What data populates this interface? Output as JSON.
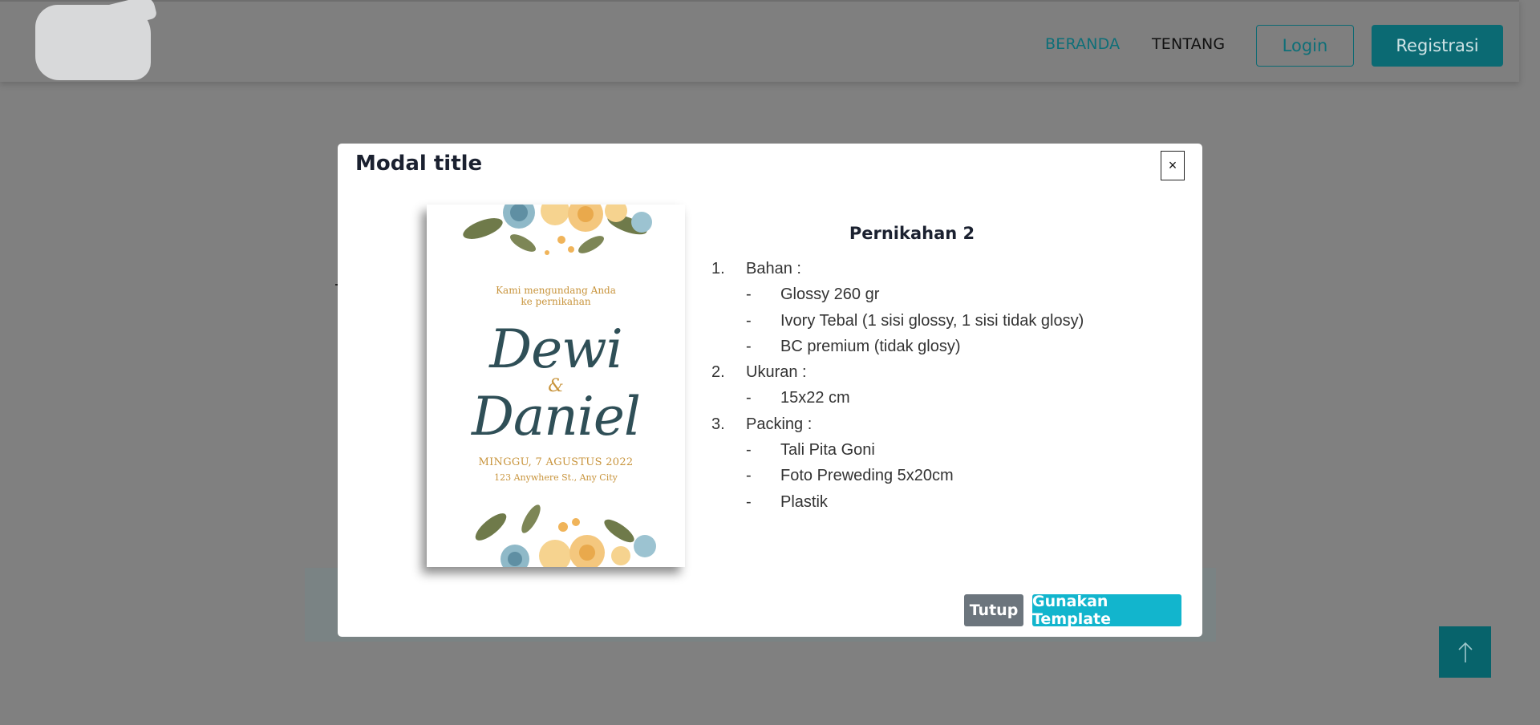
{
  "navbar": {
    "links": [
      "BERANDA",
      "TENTANG"
    ],
    "login_label": "Login",
    "register_label": "Registrasi"
  },
  "modal": {
    "title": "Modal title",
    "close_label": "×",
    "preview": {
      "lead_line1": "Kami mengundang Anda",
      "lead_line2": "ke pernikahan",
      "name1": "Dewi",
      "ampersand": "&",
      "name2": "Daniel",
      "date": "MINGGU, 7 AGUSTUS 2022",
      "address": "123 Anywhere St., Any City"
    },
    "product_title": "Pernikahan 2",
    "specs": [
      {
        "num": "1.",
        "label": "Bahan :",
        "items": [
          "Glossy 260 gr",
          "Ivory Tebal (1 sisi glossy, 1 sisi tidak glosy)",
          "BC premium (tidak glosy)"
        ]
      },
      {
        "num": "2.",
        "label": "Ukuran :",
        "items": [
          "15x22 cm"
        ]
      },
      {
        "num": "3.",
        "label": "Packing :",
        "items": [
          "Tali Pita Goni",
          "Foto Preweding 5x20cm",
          "Plastik"
        ]
      }
    ],
    "dash": "-",
    "close_button": "Tutup",
    "use_template_button": "Gunakan Template"
  },
  "colors": {
    "accent": "#0b6a73",
    "info_button": "#12b5cd",
    "secondary_button": "#6c757d"
  }
}
